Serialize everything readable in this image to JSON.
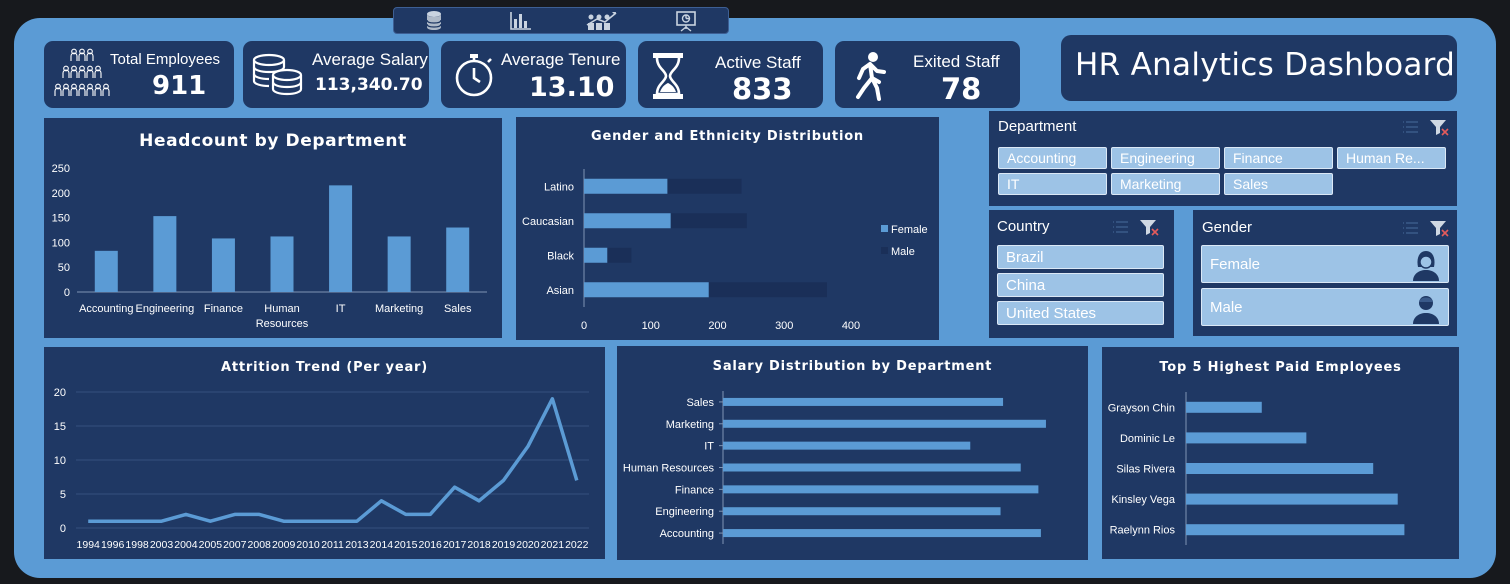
{
  "colors": {
    "frame": "#5b9bd5",
    "panel": "#1f3864",
    "bar": "#5b9bd5",
    "slicer_item": "#9dc3e6"
  },
  "topnav": {
    "icons": [
      "database-icon",
      "bar-chart-icon",
      "team-growth-icon",
      "presentation-icon"
    ]
  },
  "dashboard_title": "HR Analytics Dashboard",
  "kpis": {
    "total_employees": {
      "label": "Total Employees",
      "value": "911",
      "icon": "people-group-icon"
    },
    "average_salary": {
      "label": "Average Salary",
      "value": "113,340.70",
      "icon": "coins-icon"
    },
    "average_tenure": {
      "label": "Average Tenure",
      "value": "13.10",
      "icon": "stopwatch-icon"
    },
    "active_staff": {
      "label": "Active Staff",
      "value": "833",
      "icon": "hourglass-icon"
    },
    "exited_staff": {
      "label": "Exited Staff",
      "value": "78",
      "icon": "walking-person-icon"
    }
  },
  "slicers": {
    "department": {
      "title": "Department",
      "items": [
        "Accounting",
        "Engineering",
        "Finance",
        "Human Re...",
        "IT",
        "Marketing",
        "Sales"
      ]
    },
    "country": {
      "title": "Country",
      "items": [
        "Brazil",
        "China",
        "United States"
      ]
    },
    "gender": {
      "title": "Gender",
      "items": [
        "Female",
        "Male"
      ]
    }
  },
  "chart_data": [
    {
      "id": "headcount",
      "type": "bar",
      "title": "Headcount by Department",
      "categories": [
        "Accounting",
        "Engineering",
        "Finance",
        "Human Resources",
        "IT",
        "Marketing",
        "Sales"
      ],
      "category_labels": [
        [
          "Accounting"
        ],
        [
          "Engineering"
        ],
        [
          "Finance"
        ],
        [
          "Human",
          "Resources"
        ],
        [
          "IT"
        ],
        [
          "Marketing"
        ],
        [
          "Sales"
        ]
      ],
      "values": [
        83,
        153,
        108,
        112,
        215,
        112,
        130
      ],
      "ylim": [
        0,
        250
      ],
      "yticks": [
        "0",
        "50",
        "100",
        "150",
        "200",
        "250"
      ],
      "grid": false
    },
    {
      "id": "gender_ethnicity",
      "type": "bar",
      "orientation": "horizontal",
      "stacked": true,
      "title": "Gender and Ethnicity Distribution",
      "categories": [
        "Latino",
        "Caucasian",
        "Black",
        "Asian"
      ],
      "series": [
        {
          "name": "Female",
          "values": [
            125,
            130,
            35,
            187
          ]
        },
        {
          "name": "Male",
          "values": [
            111,
            114,
            36,
            177
          ]
        }
      ],
      "xlim": [
        0,
        400
      ],
      "xticks": [
        "0",
        "100",
        "200",
        "300",
        "400"
      ],
      "legend": "right"
    },
    {
      "id": "attrition",
      "type": "line",
      "title": "Attrition Trend (Per year)",
      "x": [
        "1994",
        "1996",
        "1998",
        "2003",
        "2004",
        "2005",
        "2007",
        "2008",
        "2009",
        "2010",
        "2011",
        "2013",
        "2014",
        "2015",
        "2016",
        "2017",
        "2018",
        "2019",
        "2020",
        "2021",
        "2022"
      ],
      "values": [
        1,
        1,
        1,
        1,
        2,
        1,
        2,
        2,
        1,
        1,
        1,
        1,
        4,
        2,
        2,
        6,
        4,
        7,
        12,
        19,
        7
      ],
      "ylim": [
        0,
        20
      ],
      "yticks": [
        "0",
        "5",
        "10",
        "15",
        "20"
      ],
      "grid": true
    },
    {
      "id": "salary_dept",
      "type": "bar",
      "orientation": "horizontal",
      "title": "Salary Distribution by Department",
      "categories": [
        "Sales",
        "Marketing",
        "IT",
        "Human Resources",
        "Finance",
        "Engineering",
        "Accounting"
      ],
      "values": [
        111000,
        128000,
        98000,
        118000,
        125000,
        110000,
        126000
      ],
      "xlim": [
        0,
        130000
      ]
    },
    {
      "id": "top5",
      "type": "bar",
      "orientation": "horizontal",
      "title": "Top 5 Highest Paid Employees",
      "categories": [
        "Grayson Chin",
        "Dominic Le",
        "Silas Rivera",
        "Kinsley Vega",
        "Raelynn Rios"
      ],
      "values": [
        179000,
        199000,
        229000,
        240000,
        243000
      ],
      "xlim": [
        145000,
        250000
      ]
    }
  ]
}
